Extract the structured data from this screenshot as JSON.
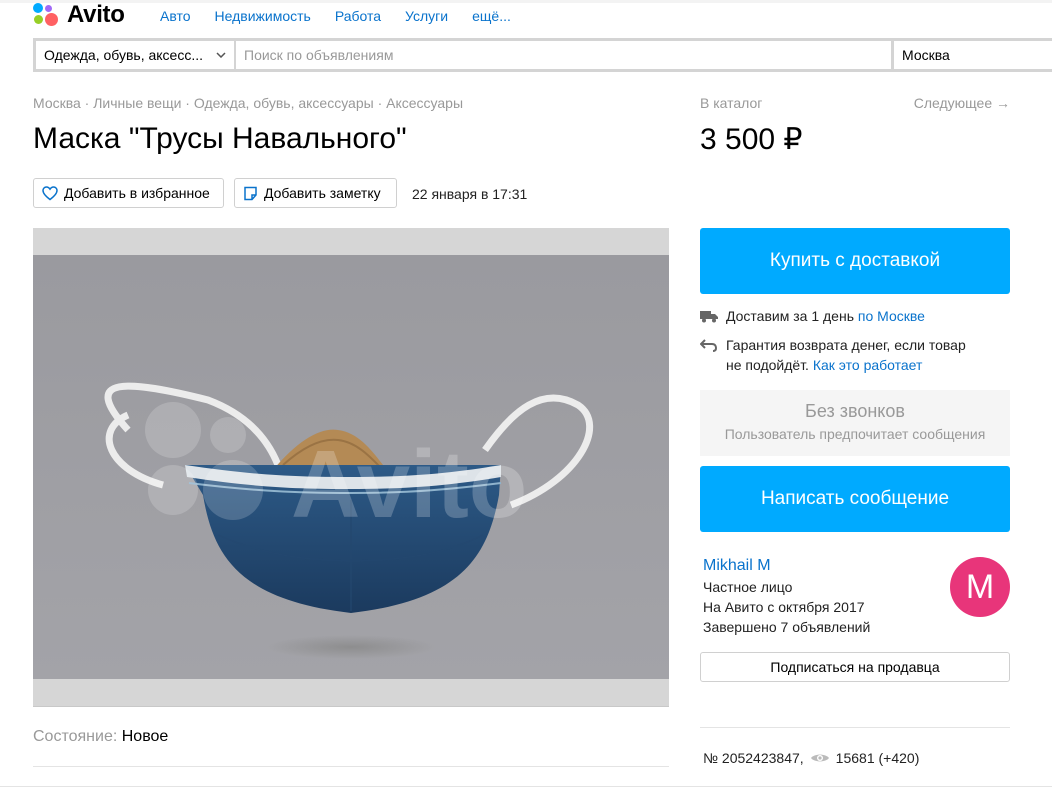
{
  "header": {
    "logo": "Avito",
    "nav": [
      "Авто",
      "Недвижимость",
      "Работа",
      "Услуги",
      "ещё..."
    ]
  },
  "search": {
    "category": "Одежда, обувь, аксесс...",
    "placeholder": "Поиск по объявлениям",
    "city": "Москва"
  },
  "breadcrumbs": "Москва · Личные вещи · Одежда, обувь, аксессуары · Аксессуары",
  "listing": {
    "title": "Маска \"Трусы Навального\"",
    "price": "3 500 ₽",
    "favorite_label": "Добавить в избранное",
    "note_label": "Добавить заметку",
    "date": "22 января в 17:31",
    "condition_label": "Состояние:",
    "condition_value": "Новое",
    "watermark": "Avito"
  },
  "sidebar": {
    "catalog_link": "В каталог",
    "next_link": "Следующее →",
    "buy_button": "Купить с доставкой",
    "delivery_text": "Доставим за 1 день",
    "delivery_link": "по Москве",
    "guarantee_line1": "Гарантия возврата денег, если товар",
    "guarantee_line2": "не подойдёт.",
    "guarantee_link": "Как это работает",
    "no_calls_title": "Без звонков",
    "no_calls_sub": "Пользователь предпочитает сообщения",
    "message_button": "Написать сообщение",
    "seller": {
      "name": "Mikhail M",
      "type": "Частное лицо",
      "since": "На Авито с октября 2017",
      "completed": "Завершено 7 объявлений",
      "avatar_letter": "M"
    },
    "subscribe_button": "Подписаться на продавца",
    "ad_number": "№ 2052423847,",
    "views": "15681 (+420)"
  },
  "colors": {
    "accent_blue": "#00aaff",
    "link_blue": "#0a73cc",
    "avatar_pink": "#e8357a"
  },
  "icons": [
    "heart-icon",
    "note-icon",
    "chevron-down-icon",
    "truck-icon",
    "return-arrow-icon",
    "eye-icon"
  ]
}
